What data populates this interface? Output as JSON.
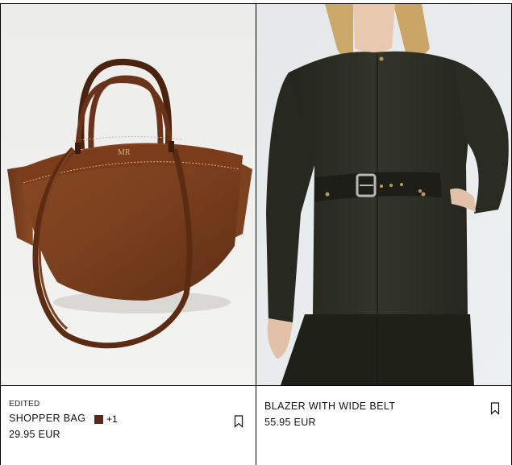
{
  "products": [
    {
      "tag": "EDITED",
      "name": "SHOPPER BAG",
      "swatch_color": "#5a2a14",
      "more_colors": "+1",
      "price": "29.95 EUR",
      "monogram": "MR",
      "icon": "bookmark-icon"
    },
    {
      "name": "BLAZER WITH WIDE BELT",
      "price": "55.95 EUR",
      "icon": "bookmark-icon"
    }
  ]
}
